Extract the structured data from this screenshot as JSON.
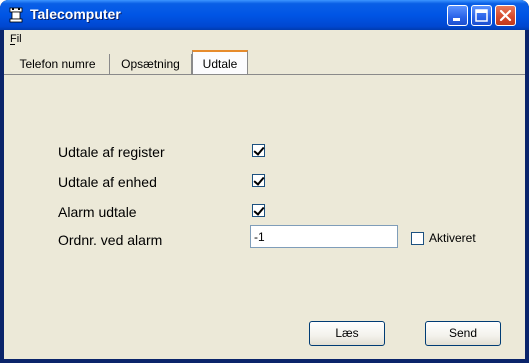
{
  "window": {
    "title": "Talecomputer"
  },
  "menu": {
    "items": [
      "Fil"
    ]
  },
  "tabs": [
    "Telefon numre",
    "Opsætning",
    "Udtale"
  ],
  "active_tab": "Udtale",
  "form": {
    "register_label": "Udtale af register",
    "register_checked": true,
    "device_label": "Udtale af enhed",
    "device_checked": true,
    "alarm_label": "Alarm udtale",
    "alarm_checked": true,
    "ordnr_label": "Ordnr. ved alarm",
    "ordnr_value": "-1",
    "activated_label": "Aktiveret",
    "activated_checked": false
  },
  "buttons": {
    "read_label": "Læs",
    "send_label": "Send"
  },
  "colors": {
    "titlebar": "#0055e5",
    "client": "#ece9d8",
    "tab_accent": "#e68b2c",
    "close": "#d4482b"
  },
  "icons": {
    "app": "rook-icon",
    "minimize": "minimize-icon",
    "maximize": "maximize-icon",
    "close": "close-icon"
  }
}
